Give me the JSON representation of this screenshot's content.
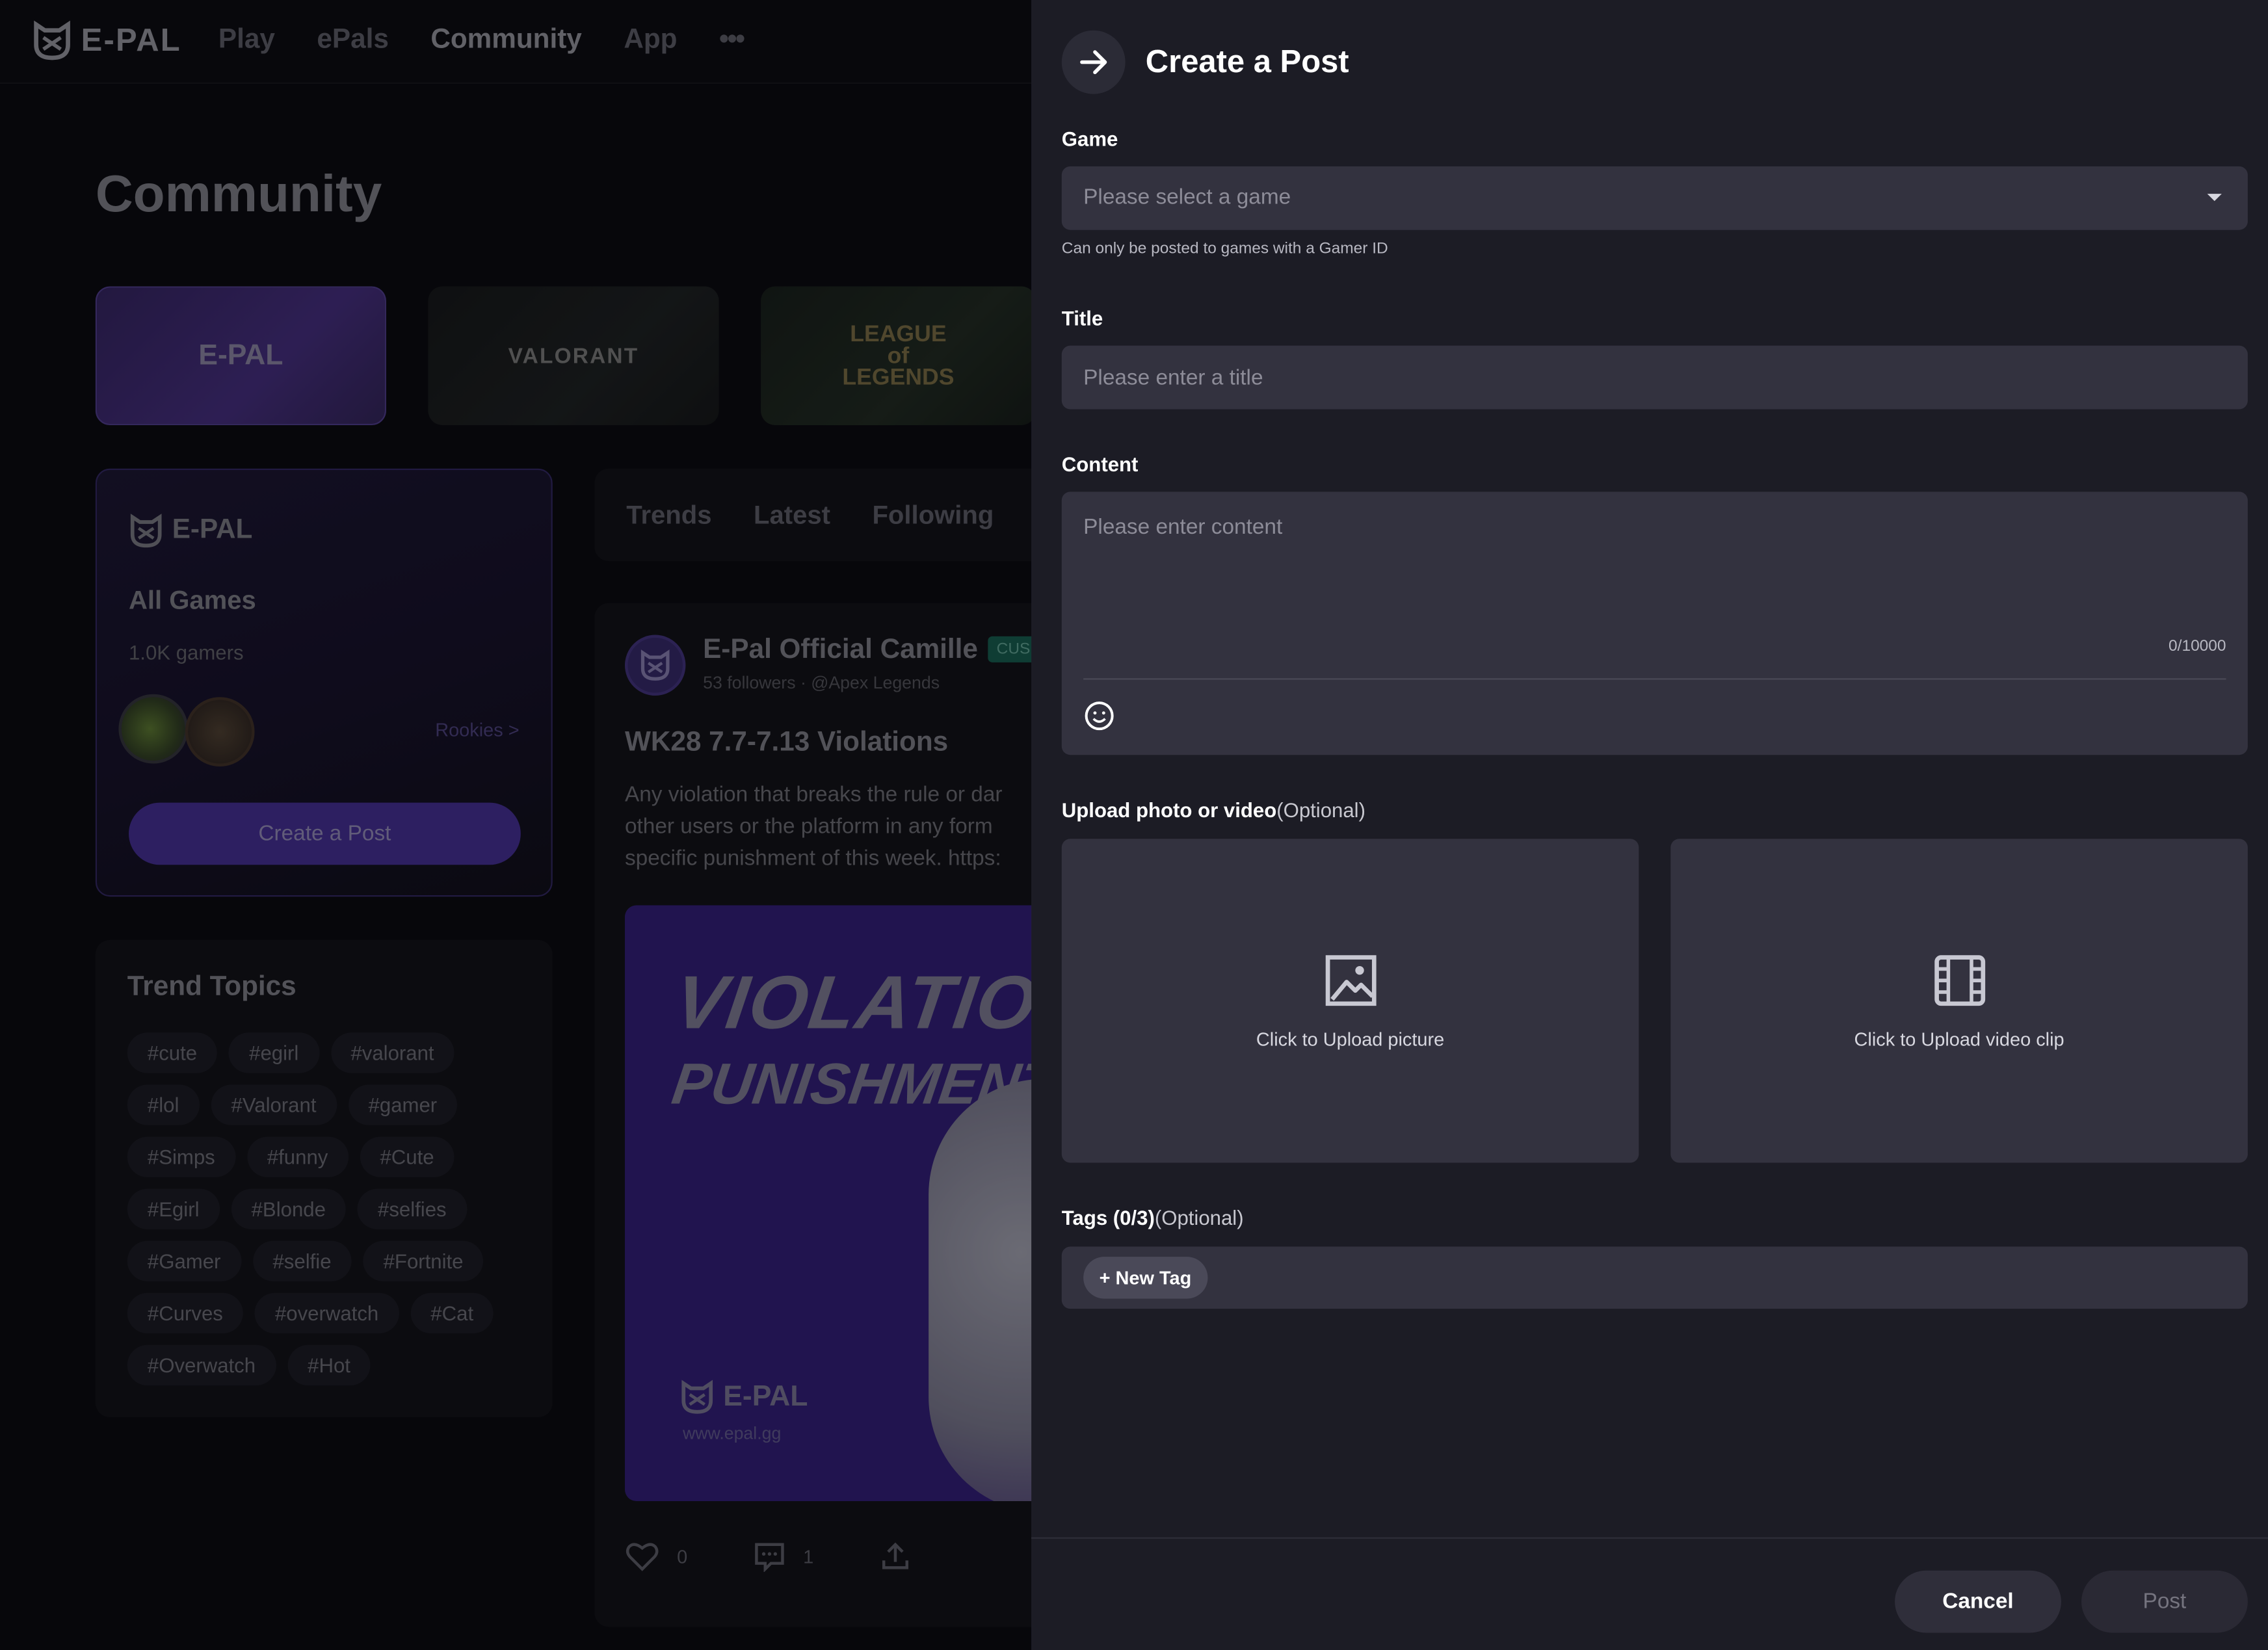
{
  "header": {
    "brand": "E-PAL",
    "nav": [
      "Play",
      "ePals",
      "Community",
      "App"
    ],
    "more": "•••"
  },
  "page": {
    "title": "Community",
    "game_cards": [
      "E-PAL",
      "VALORANT",
      "LEAGUE of LEGENDS"
    ]
  },
  "all_games": {
    "brand": "E-PAL",
    "title": "All Games",
    "count": "1.0K",
    "count_suffix": " gamers",
    "rookies": "Rookies >",
    "create_label": "Create a Post"
  },
  "trend_topics": {
    "title": "Trend Topics",
    "tags": [
      "#cute",
      "#egirl",
      "#valorant",
      "#lol",
      "#Valorant",
      "#gamer",
      "#Simps",
      "#funny",
      "#Cute",
      "#Egirl",
      "#Blonde",
      "#selfies",
      "#Gamer",
      "#selfie",
      "#Fortnite",
      "#Curves",
      "#overwatch",
      "#Cat",
      "#Overwatch",
      "#Hot"
    ]
  },
  "feed_tabs": [
    "Trends",
    "Latest",
    "Following"
  ],
  "post": {
    "author": "E-Pal Official Camille",
    "badge": "CUS",
    "meta": "53 followers · @Apex Legends",
    "title": "WK28 7.7-7.13 Violations",
    "body_lines": [
      "Any violation that breaks the rule or dar",
      "other users or the platform in any form",
      "specific punishment of this week. https:"
    ],
    "image_line1": "VIOLATION",
    "image_line2": "PUNISHMENTS",
    "image_brand": "E-PAL",
    "image_url": "www.epal.gg",
    "likes": "0",
    "comments": "1"
  },
  "drawer": {
    "title": "Create a Post",
    "game_label": "Game",
    "game_placeholder": "Please select a game",
    "game_hint": "Can only be posted to games with a Gamer ID",
    "title_label": "Title",
    "title_placeholder": "Please enter a title",
    "content_label": "Content",
    "content_placeholder": "Please enter content",
    "content_counter": "0/10000",
    "upload_label": "Upload photo or video",
    "upload_optional": "(Optional)",
    "upload_picture": "Click to Upload picture",
    "upload_video": "Click to Upload video clip",
    "tags_label": "Tags (0/3)",
    "tags_optional": "(Optional)",
    "new_tag": "+ New Tag",
    "cancel": "Cancel",
    "post": "Post"
  },
  "colors": {
    "accent": "#4e36a8",
    "drawer_bg": "#1c1c25",
    "field_bg": "#33323f"
  }
}
